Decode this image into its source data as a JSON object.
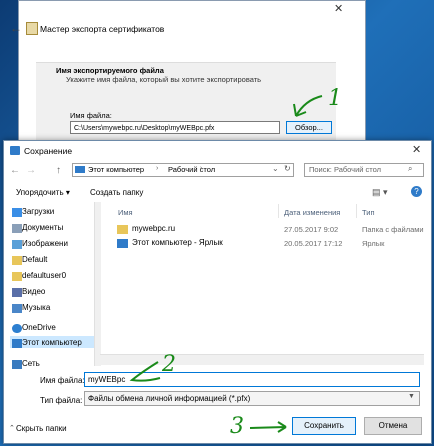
{
  "wizard": {
    "title": "Мастер экспорта сертификатов",
    "section_title": "Имя экспортируемого файла",
    "section_subtitle": "Укажите имя файла, который вы хотите экспортировать",
    "file_label": "Имя файла:",
    "file_path": "C:\\Users\\mywebpc.ru\\Desktop\\myWEBpc.pfx",
    "browse_label": "Обзор..."
  },
  "dialog": {
    "title": "Сохранение",
    "address": {
      "computer": "Этот компьютер",
      "separator": "›",
      "folder": "Рабочий стол"
    },
    "search_placeholder": "Поиск: Рабочий стол",
    "toolbar": {
      "organize": "Упорядочить ▾",
      "new_folder": "Создать папку",
      "help": "?"
    },
    "nav_items": [
      {
        "label": "Загрузки",
        "icon": "downloads-icon"
      },
      {
        "label": "Документы",
        "icon": "documents-icon"
      },
      {
        "label": "Изображени",
        "icon": "pictures-icon"
      },
      {
        "label": "Default",
        "icon": "folder-icon"
      },
      {
        "label": "defaultuser0",
        "icon": "folder-icon"
      },
      {
        "label": "Видео",
        "icon": "video-icon"
      },
      {
        "label": "Музыка",
        "icon": "music-icon"
      },
      {
        "label": "OneDrive",
        "icon": "onedrive-icon"
      },
      {
        "label": "Этот компьютер",
        "icon": "computer-icon"
      },
      {
        "label": "Сеть",
        "icon": "network-icon"
      }
    ],
    "columns": {
      "name": "Имя",
      "date": "Дата изменения",
      "type": "Тип"
    },
    "files": [
      {
        "name": "mywebpc.ru",
        "date": "27.05.2017 9:02",
        "type": "Папка с файлами"
      },
      {
        "name": "Этот компьютер - Ярлык",
        "date": "20.05.2017 17:12",
        "type": "Ярлык"
      }
    ],
    "filename_label": "Имя файла:",
    "filename_value": "myWEBpc",
    "filetype_label": "Тип файла:",
    "filetype_value": "Файлы обмена личной информацией (*.pfx)",
    "hide_folders": "Скрыть папки",
    "save_label": "Сохранить",
    "cancel_label": "Отмена"
  },
  "annotations": {
    "step1": "1",
    "step2": "2",
    "step3": "3"
  },
  "colors": {
    "accent": "#0078d7",
    "annotation": "#1a8a1a",
    "selection": "#cce8ff"
  }
}
